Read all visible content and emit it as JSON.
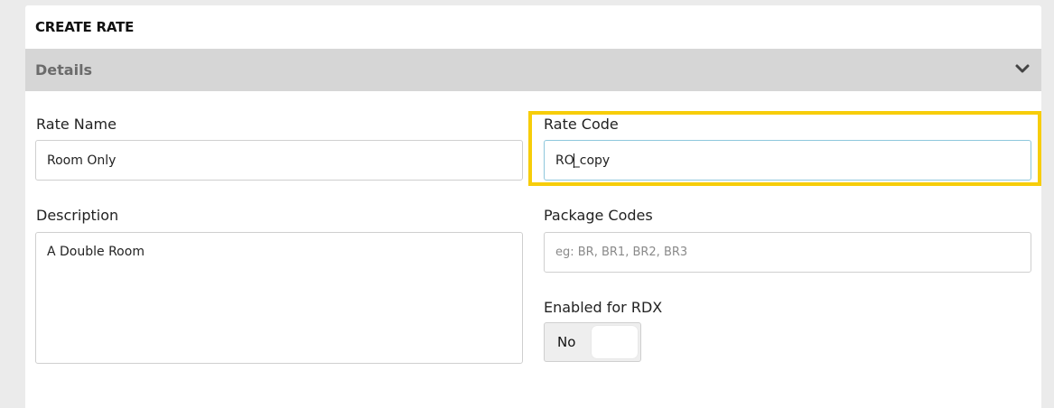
{
  "panel": {
    "title": "CREATE RATE"
  },
  "section": {
    "title": "Details",
    "toggle_icon": "chevron-down-icon"
  },
  "fields": {
    "rate_name": {
      "label": "Rate Name",
      "value": "Room Only"
    },
    "rate_code": {
      "label": "Rate Code",
      "value_before_caret": "RO",
      "value_after_caret": "_copy"
    },
    "description": {
      "label": "Description",
      "value": "A Double Room"
    },
    "package_codes": {
      "label": "Package Codes",
      "placeholder": "eg: BR, BR1, BR2, BR3"
    },
    "enabled_rdx": {
      "label": "Enabled for RDX",
      "state_text": "No"
    }
  },
  "colors": {
    "highlight": "#f7cd0a",
    "section_bar": "#d6d6d6",
    "focus_border": "#8ec7dc"
  }
}
